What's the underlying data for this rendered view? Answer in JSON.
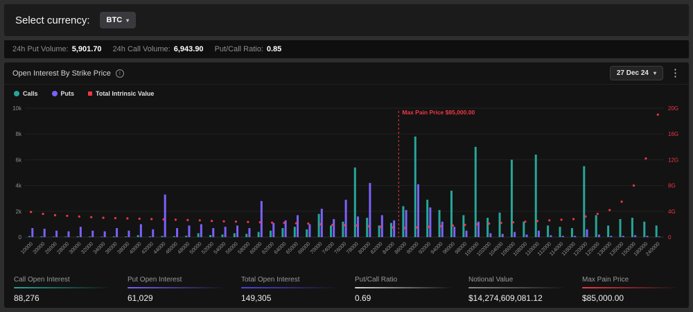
{
  "header": {
    "select_currency_label": "Select currency:",
    "currency": "BTC",
    "caret": "▾"
  },
  "volume_bar": {
    "put_volume_label": "24h Put Volume:",
    "put_volume": "5,901.70",
    "call_volume_label": "24h Call Volume:",
    "call_volume": "6,943.90",
    "ratio_label": "Put/Call Ratio:",
    "ratio": "0.85"
  },
  "panel": {
    "title": "Open Interest By Strike Price",
    "info_glyph": "i",
    "expiry": "27 Dec 24",
    "expiry_caret": "▾",
    "kebab_glyph": "⋮"
  },
  "legend": [
    {
      "label": "Calls",
      "color": "#26a69a"
    },
    {
      "label": "Puts",
      "color": "#7b61ff"
    },
    {
      "label": "Total Intrinsic Value",
      "color": "#f23645"
    }
  ],
  "chart_data": {
    "type": "bar",
    "title": "Open Interest By Strike Price",
    "categories": [
      "10000",
      "20000",
      "26000",
      "28000",
      "30000",
      "32000",
      "34000",
      "36000",
      "38000",
      "40000",
      "42000",
      "44000",
      "46000",
      "48000",
      "50000",
      "52000",
      "54000",
      "56000",
      "58000",
      "60000",
      "62000",
      "64000",
      "65000",
      "66000",
      "70000",
      "74000",
      "76000",
      "78000",
      "80000",
      "82000",
      "84000",
      "86000",
      "90000",
      "92000",
      "94000",
      "96000",
      "98000",
      "100000",
      "102000",
      "104000",
      "106000",
      "108000",
      "110000",
      "112000",
      "114000",
      "116000",
      "120000",
      "125000",
      "130000",
      "135000",
      "150000",
      "180000",
      "240000"
    ],
    "series": [
      {
        "name": "Calls",
        "type": "bar",
        "axis": "left",
        "color": "#26a69a",
        "values": [
          80,
          60,
          40,
          40,
          60,
          50,
          40,
          60,
          50,
          150,
          60,
          90,
          70,
          110,
          300,
          160,
          200,
          300,
          250,
          400,
          500,
          700,
          800,
          600,
          1800,
          900,
          1200,
          5400,
          1500,
          900,
          1100,
          2400,
          7800,
          2900,
          2100,
          3600,
          1700,
          7000,
          1500,
          1900,
          6000,
          1200,
          6400,
          900,
          800,
          700,
          5500,
          1700,
          900,
          1400,
          1500,
          1200,
          900
        ]
      },
      {
        "name": "Puts",
        "type": "bar",
        "axis": "left",
        "color": "#7b61ff",
        "values": [
          700,
          650,
          500,
          450,
          800,
          500,
          450,
          700,
          500,
          1000,
          600,
          3300,
          700,
          900,
          1000,
          700,
          800,
          900,
          700,
          2800,
          1100,
          1300,
          1700,
          1000,
          2200,
          1400,
          2900,
          1600,
          4200,
          1700,
          1300,
          2100,
          4100,
          2300,
          1200,
          800,
          500,
          1200,
          300,
          250,
          400,
          200,
          500,
          150,
          100,
          100,
          600,
          200,
          100,
          100,
          150,
          100,
          50
        ]
      },
      {
        "name": "Total Intrinsic Value",
        "type": "scatter",
        "axis": "right",
        "unit": "G",
        "color": "#f23645",
        "values": [
          3.9,
          3.6,
          3.4,
          3.3,
          3.2,
          3.1,
          3.0,
          2.95,
          2.9,
          2.85,
          2.8,
          2.75,
          2.7,
          2.65,
          2.6,
          2.5,
          2.45,
          2.4,
          2.35,
          2.3,
          2.25,
          2.2,
          2.15,
          2.1,
          2.0,
          1.9,
          1.85,
          1.8,
          1.7,
          1.6,
          1.5,
          1.4,
          1.5,
          1.6,
          1.7,
          1.8,
          1.9,
          2.0,
          2.1,
          2.2,
          2.3,
          2.4,
          2.5,
          2.6,
          2.7,
          2.8,
          3.2,
          3.6,
          4.2,
          5.5,
          8.0,
          12.2,
          19.0
        ]
      }
    ],
    "left_axis": {
      "max_value": 10000,
      "ticks": [
        "0",
        "2k",
        "4k",
        "6k",
        "8k",
        "10k"
      ],
      "color": "#8f8f8f"
    },
    "right_axis": {
      "max_value": 20,
      "ticks": [
        "0",
        "4G",
        "8G",
        "12G",
        "16G",
        "20G"
      ],
      "color": "#f23645"
    },
    "grid": true,
    "legend_position": "top-left",
    "annotation": {
      "label": "Max Pain Price $85,000.00",
      "strike": 85000,
      "color": "#f23645"
    }
  },
  "stats": [
    {
      "label": "Call Open Interest",
      "value": "88,276",
      "color": "#26a69a"
    },
    {
      "label": "Put Open Interest",
      "value": "61,029",
      "color": "#7b61ff"
    },
    {
      "label": "Total Open Interest",
      "value": "149,305",
      "color": "#4f46e5"
    },
    {
      "label": "Put/Call Ratio",
      "value": "0.69",
      "color": "#d5d5d5"
    },
    {
      "label": "Notional Value",
      "value": "$14,274,609,081.12",
      "color": "#8a8a8a"
    },
    {
      "label": "Max Pain Price",
      "value": "$85,000.00",
      "color": "#f23645"
    }
  ]
}
